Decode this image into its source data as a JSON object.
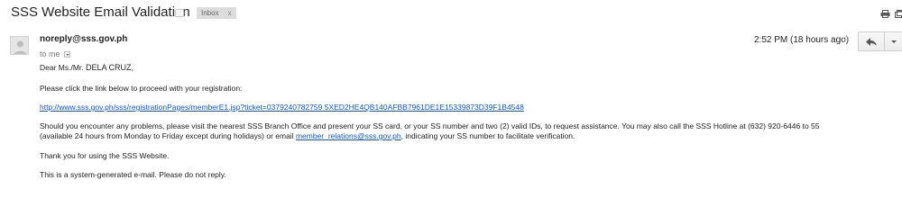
{
  "header": {
    "subject": "SSS Website Email Validation",
    "label_chip": "Inbox",
    "label_chip_close": "x"
  },
  "message": {
    "sender": "noreply@sss.gov.ph",
    "to_line": "to me",
    "timestamp": "2:52 PM (18 hours ago)",
    "greeting_prefix": "Dear Ms./Mr. ",
    "recipient_name": "DELA CRUZ,",
    "instruction": "Please click the link below to proceed with your registration:",
    "registration_link": "http://www.sss.gov.ph/sss/registrationPages/memberE1.jsp?ticket=0379240782759 5XED2HE4QB140AFBB7961DE1E15339873D39F1B4548",
    "paragraph_line1": "Should you encounter any problems, please visit the nearest SSS Branch Office and present your SS card, or your SS number and two (2) valid IDs, to request assistance. You may also call the SSS Hotline at (632) 920-6446 to 55",
    "paragraph_line2_prefix": "(available 24 hours from Monday to Friday except during holidays) or email ",
    "paragraph_email": "member_relations@sss.gov.ph",
    "paragraph_line2_suffix": ", indicating your SS number to facilitate verification.",
    "thanks": "Thank you for using the SSS Website.",
    "footer": "This is a system-generated e-mail. Please do not reply."
  },
  "icons": {
    "label_folder": "label-folder-icon",
    "print": "print-icon",
    "new_window": "new-window-icon",
    "avatar": "avatar-icon",
    "star": "star-icon",
    "reply": "reply-arrow-icon",
    "more": "chevron-down-icon"
  },
  "colors": {
    "link": "#1155cc",
    "chip_bg": "#dcdcdc"
  }
}
